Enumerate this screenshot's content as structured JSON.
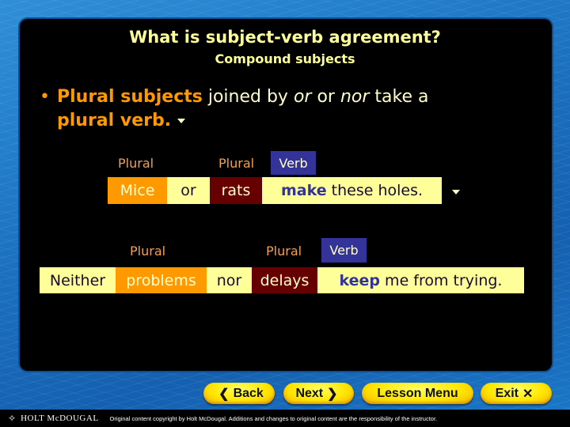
{
  "slide": {
    "title": "What is subject-verb agreement?",
    "subtitle": "Compound subjects"
  },
  "bullet": {
    "marker": "•",
    "part1_bold": "Plural subjects",
    "part2": " joined by ",
    "part3_italic": "or",
    "part4": " or ",
    "part5_italic": "nor",
    "part6": " take a ",
    "part7_bold": "plural verb."
  },
  "example1": {
    "labels": {
      "subject1": "Plural",
      "subject2": "Plural",
      "verb": "Verb"
    },
    "words": {
      "subject1": "Mice",
      "conjunction": "or",
      "subject2": "rats",
      "verb": "make",
      "rest": " these holes."
    }
  },
  "example2": {
    "labels": {
      "subject1": "Plural",
      "subject2": "Plural",
      "verb": "Verb"
    },
    "words": {
      "lead": "Neither",
      "subject1": "problems",
      "conjunction": "nor",
      "subject2": "delays",
      "verb": "keep",
      "rest": " me from trying."
    }
  },
  "nav": {
    "back": "Back",
    "next": "Next",
    "lesson_menu": "Lesson Menu",
    "exit": "Exit"
  },
  "footer": {
    "brand": "HOLT McDOUGAL",
    "copyright": "Original content copyright by Holt McDougal.  Additions and changes to original content are the responsibility of the instructor."
  },
  "colors": {
    "subject_highlight": "#ff9900",
    "second_subject_highlight": "#660000",
    "sentence_background": "#ffff99",
    "verb_color": "#333399",
    "title_color": "#ffff99"
  }
}
